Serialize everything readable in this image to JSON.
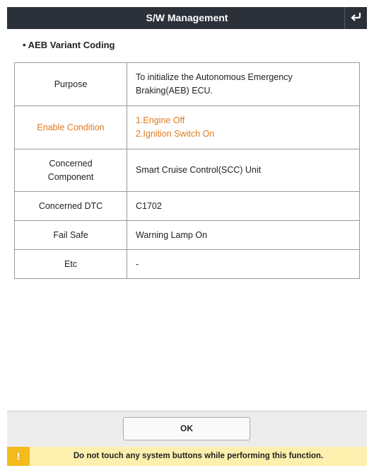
{
  "header": {
    "title": "S/W Management",
    "back_icon": "return-icon"
  },
  "section": {
    "title": "• AEB Variant Coding"
  },
  "table": {
    "rows": [
      {
        "label": "Purpose",
        "lines": [
          "To initialize the Autonomous Emergency",
          "Braking(AEB) ECU."
        ]
      },
      {
        "label": "Enable Condition",
        "lines": [
          "1.Engine Off",
          "2.Ignition Switch On"
        ],
        "highlight_color": "#e07a1f"
      },
      {
        "label_lines": [
          "Concerned",
          "Component"
        ],
        "lines": [
          "Smart Cruise Control(SCC) Unit"
        ]
      },
      {
        "label": "Concerned DTC",
        "lines": [
          "C1702"
        ]
      },
      {
        "label": "Fail Safe",
        "lines": [
          "Warning Lamp On"
        ]
      },
      {
        "label": "Etc",
        "lines": [
          "-"
        ]
      }
    ]
  },
  "footer": {
    "ok_label": "OK"
  },
  "warning": {
    "icon": "!",
    "text": "Do not touch any system buttons while performing this function."
  }
}
